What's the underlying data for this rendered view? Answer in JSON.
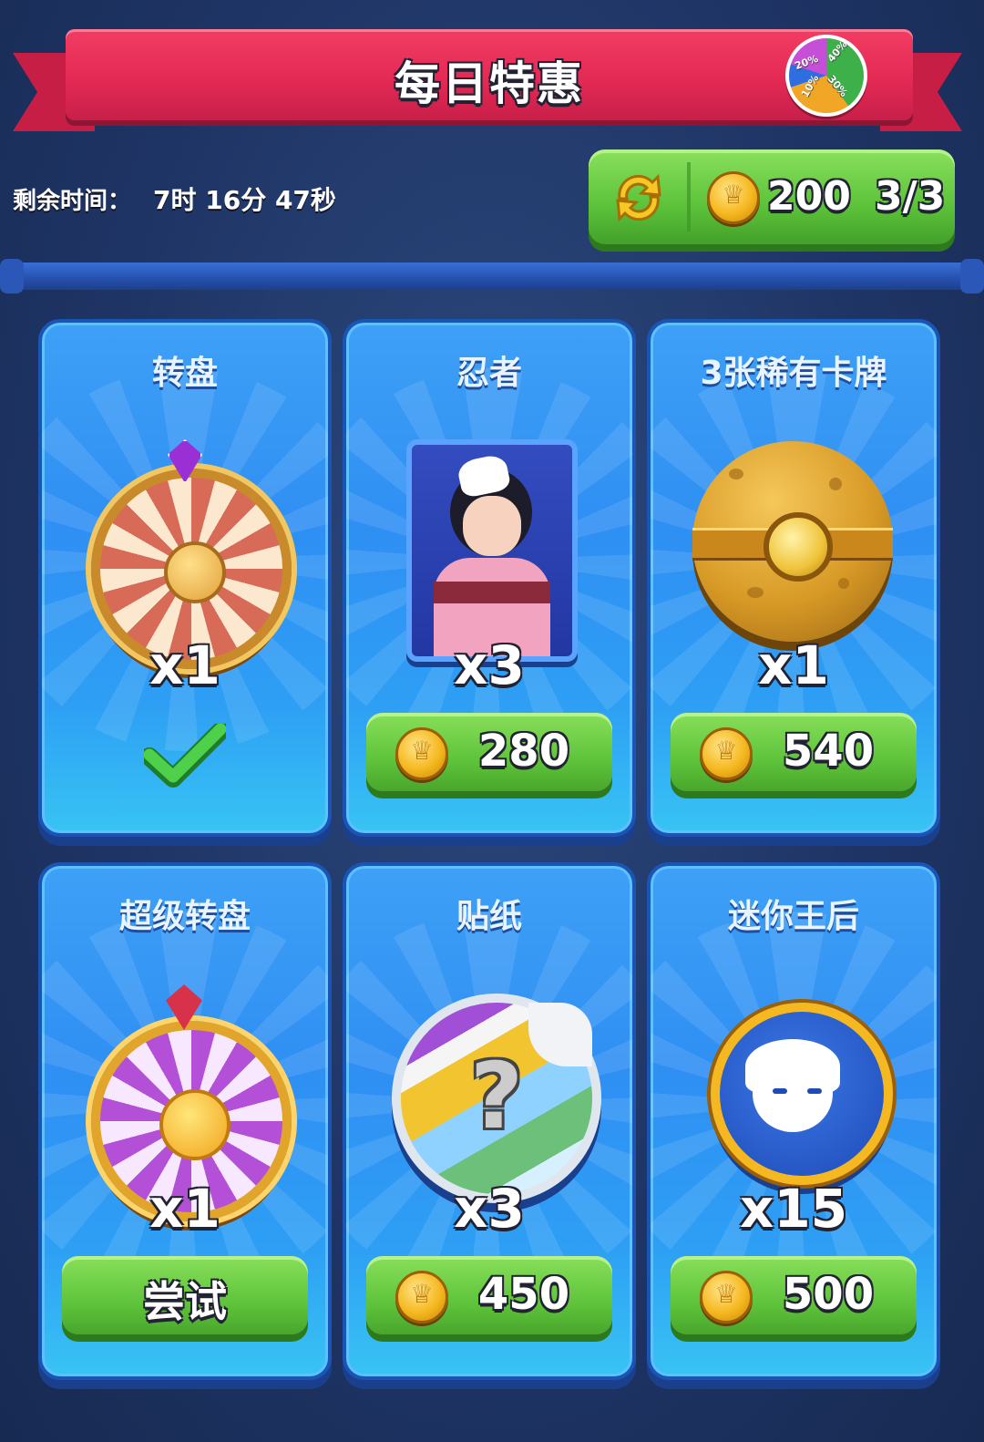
{
  "header": {
    "title": "每日特惠",
    "wheel_badge": {
      "segments": [
        "20%",
        "40%",
        "10%",
        "30%"
      ]
    }
  },
  "timer": {
    "label": "剩余时间：",
    "value": "7时 16分 47秒"
  },
  "refresh": {
    "cost": "200",
    "count": "3/3",
    "icon": "refresh-arrows-icon"
  },
  "offers": [
    {
      "title": "转盘",
      "qty": "x1",
      "state": "claimed",
      "item_icon": "wheel-icon"
    },
    {
      "title": "忍者",
      "qty": "x3",
      "price": "280",
      "item_icon": "ninja-card-icon"
    },
    {
      "title": "3张稀有卡牌",
      "qty": "x1",
      "price": "540",
      "item_icon": "card-orb-icon"
    },
    {
      "title": "超级转盘",
      "qty": "x1",
      "button_label": "尝试",
      "item_icon": "super-wheel-icon"
    },
    {
      "title": "贴纸",
      "qty": "x3",
      "price": "450",
      "item_icon": "sticker-icon"
    },
    {
      "title": "迷你王后",
      "qty": "x15",
      "price": "500",
      "item_icon": "mini-queen-icon"
    }
  ],
  "colors": {
    "ribbon": "#e32a55",
    "card": "#2f8ff3",
    "button_green": "#5cc23a",
    "background": "#1f3566"
  }
}
